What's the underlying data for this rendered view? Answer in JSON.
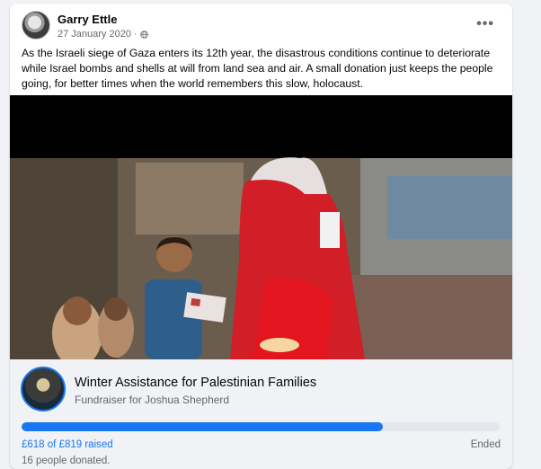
{
  "post": {
    "author": "Garry Ettle",
    "date": "27 January 2020",
    "separator": "·",
    "privacy_icon": "globe-icon",
    "more_icon": "more-options-icon",
    "more_label": "•••",
    "text": "As the Israeli siege of Gaza enters its 12th year, the disastrous conditions continue to deteriorate while Israel bombs and shells at will from land sea and air. A small donation just keeps the people going, for better times when the world remembers this slow, holocaust."
  },
  "fundraiser": {
    "title": "Winter Assistance for Palestinian Families",
    "subtitle": "Fundraiser for Joshua Shepherd",
    "raised_label": "£618 of £819 raised",
    "raised": 618,
    "goal": 819,
    "progress_fraction": 0.755,
    "status": "Ended",
    "donors_label": "16 people donated."
  },
  "colors": {
    "accent": "#1877f2",
    "secondary_text": "#65676b",
    "fundraiser_bg": "#f0f2f5"
  }
}
